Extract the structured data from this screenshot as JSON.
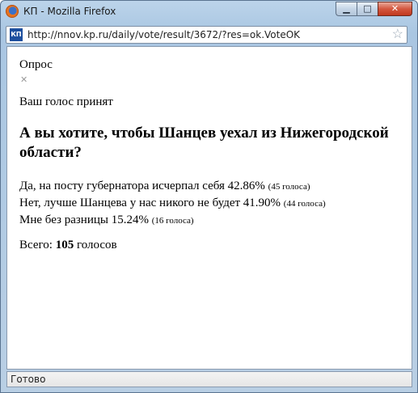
{
  "window": {
    "title": "КП - Mozilla Firefox",
    "controls": {
      "minimize": "▁",
      "maximize": "□",
      "close": "✕"
    }
  },
  "address_bar": {
    "site_icon": "КП",
    "url": "http://nnov.kp.ru/daily/vote/result/3672/?res=ok.VoteOK",
    "bookmark_icon": "☆"
  },
  "page": {
    "poll_label": "Опрос",
    "close_mark": "✕",
    "accepted_message": "Ваш голос принят",
    "question": "А вы хотите, чтобы Шанцев уехал из Нижегородской области?",
    "results": [
      {
        "answer": "Да, на посту губернатора исчерпал себя",
        "percent": "42.86%",
        "votes": "(45 голоса)"
      },
      {
        "answer": "Нет, лучше Шанцева у нас никого не будет",
        "percent": "41.90%",
        "votes": "(44 голоса)"
      },
      {
        "answer": "Мне без разницы",
        "percent": "15.24%",
        "votes": "(16 голоса)"
      }
    ],
    "total_label": "Всего:",
    "total_count": "105",
    "total_unit": "голосов"
  },
  "status_bar": {
    "text": "Готово"
  }
}
